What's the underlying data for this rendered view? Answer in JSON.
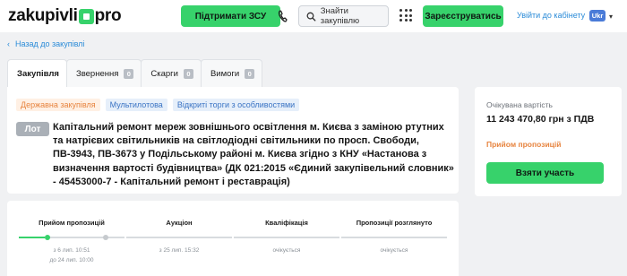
{
  "header": {
    "logo_left": "zakupivli",
    "logo_right": "pro",
    "support_button": "Підтримати ЗСУ",
    "search_label": "Знайти закупівлю",
    "register_button": "Зареєструватись",
    "cabinet_link": "Увійти до кабінету",
    "language": "Ukr",
    "accent_color": "#37d26b"
  },
  "back_link": "Назад до закупівлі",
  "tabs": [
    {
      "label": "Закупівля",
      "active": true
    },
    {
      "label": "Звернення",
      "count": "0"
    },
    {
      "label": "Скарги",
      "count": "0"
    },
    {
      "label": "Вимоги",
      "count": "0"
    }
  ],
  "tags": [
    "Державна закупівля",
    "Мультилотова",
    "Відкриті торги з особливостями"
  ],
  "lot": {
    "badge": "Лот",
    "title": "Капітальний ремонт мереж зовнішнього освітлення м. Києва з заміною ртутних та натрієвих світильників на світлодіодні світильники по просп. Свободи, ПВ-3943, ПВ-3673 у Подільському районі м. Києва згідно з КНУ «Настанова з визначення вартості будівництва» (ДК 021:2015 «Єдиний закупівельний словник» - 45453000-7 - Капітальний ремонт і реставрація)"
  },
  "side": {
    "label": "Очікувана вартість",
    "value": "11 243 470,80 грн з ПДВ",
    "status": "Прийом пропозицій",
    "button": "Взяти участь"
  },
  "timeline": {
    "progress_first_stage": 0.62,
    "stages": [
      {
        "title": "Прийом пропозицій",
        "note1": "з 6 лип. 10:51",
        "note2": "до 24 лип. 10:00"
      },
      {
        "title": "Аукціон",
        "note1": "з 25 лип. 15:32",
        "note2": ""
      },
      {
        "title": "Кваліфікація",
        "note1": "очікується",
        "note2": ""
      },
      {
        "title": "Пропозиції розглянуто",
        "note1": "очікується",
        "note2": ""
      }
    ]
  }
}
